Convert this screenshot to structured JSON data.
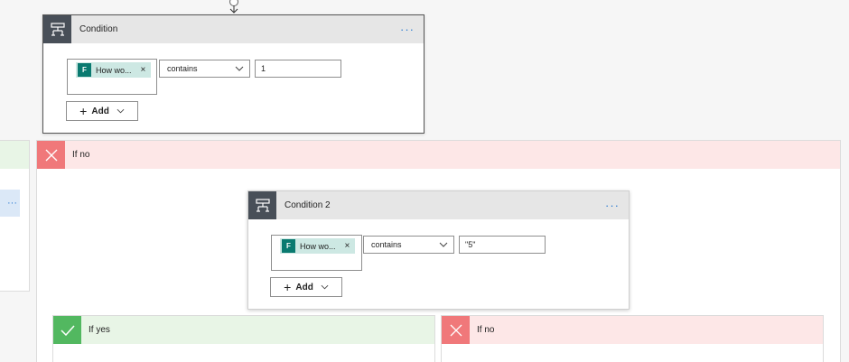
{
  "condition1": {
    "title": "Condition",
    "more": "···",
    "token_label": "How wo...",
    "token_remove": "×",
    "operator": "contains",
    "value": "1",
    "add_label": "Add"
  },
  "if_no_1": {
    "label": "If no"
  },
  "condition2": {
    "title": "Condition 2",
    "more": "···",
    "token_label": "How wo...",
    "token_remove": "×",
    "operator": "contains",
    "value": "\"5\"",
    "add_label": "Add"
  },
  "if_yes_2": {
    "label": "If yes"
  },
  "if_no_2": {
    "label": "If no"
  },
  "left_partial": {
    "more": "···"
  },
  "colors": {
    "no_header_bg": "#fde7e7",
    "no_icon_bg": "#f0787a",
    "yes_header_bg": "#e8f5e6",
    "yes_icon_bg": "#52b860",
    "condition_icon_bg": "#484f58",
    "accent_more": "#2b7bd1"
  },
  "icons": {
    "condition": "condition-icon",
    "forms": "microsoft-forms-icon",
    "no": "close-icon",
    "yes": "checkmark-icon",
    "connector_arrow": "arrow-down-icon"
  }
}
